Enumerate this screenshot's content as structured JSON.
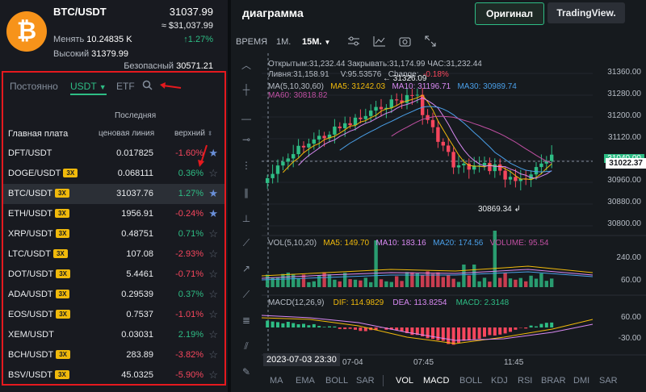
{
  "header": {
    "coin_symbol": "₿",
    "pair": "BTC/USDT",
    "price": "31037.99",
    "price_usd": "≈ $31,037.99",
    "change_label": "Менять",
    "change_value": "10.24835 K",
    "change_pct": "↑1.27%",
    "high_label": "Высокий",
    "high_value": "31379.99",
    "safe_label": "Безопасный",
    "safe_value": "30571.21"
  },
  "market": {
    "tabs": [
      {
        "label": "Постоянно"
      },
      {
        "label": "USDT"
      },
      {
        "label": "ETF"
      }
    ],
    "search_icon": "search-icon",
    "col_name": "Главная плата",
    "col_last_top": "Последняя",
    "col_last": "ценовая линия",
    "col_upper": "верхний",
    "rows": [
      {
        "sym": "DFT/USDT",
        "lev": "",
        "price": "0.017825",
        "chg": "-1.60%",
        "dir": "down",
        "fav": true
      },
      {
        "sym": "DOGE/USDT",
        "lev": "3X",
        "price": "0.068111",
        "chg": "0.36%",
        "dir": "up",
        "fav": false
      },
      {
        "sym": "BTC/USDT",
        "lev": "3X",
        "price": "31037.76",
        "chg": "1.27%",
        "dir": "up",
        "fav": true
      },
      {
        "sym": "ETH/USDT",
        "lev": "3X",
        "price": "1956.91",
        "chg": "-0.24%",
        "dir": "down",
        "fav": true
      },
      {
        "sym": "XRP/USDT",
        "lev": "3X",
        "price": "0.48751",
        "chg": "0.71%",
        "dir": "up",
        "fav": false
      },
      {
        "sym": "LTC/USDT",
        "lev": "3X",
        "price": "107.08",
        "chg": "-2.93%",
        "dir": "down",
        "fav": false
      },
      {
        "sym": "DOT/USDT",
        "lev": "3X",
        "price": "5.4461",
        "chg": "-0.71%",
        "dir": "down",
        "fav": false
      },
      {
        "sym": "ADA/USDT",
        "lev": "3X",
        "price": "0.29539",
        "chg": "0.37%",
        "dir": "up",
        "fav": false
      },
      {
        "sym": "EOS/USDT",
        "lev": "3X",
        "price": "0.7537",
        "chg": "-1.01%",
        "dir": "down",
        "fav": false
      },
      {
        "sym": "XEM/USDT",
        "lev": "",
        "price": "0.03031",
        "chg": "2.19%",
        "dir": "up",
        "fav": false
      },
      {
        "sym": "BCH/USDT",
        "lev": "3X",
        "price": "283.89",
        "chg": "-3.82%",
        "dir": "down",
        "fav": false
      },
      {
        "sym": "BSV/USDT",
        "lev": "3X",
        "price": "45.0325",
        "chg": "-5.90%",
        "dir": "down",
        "fav": false
      }
    ]
  },
  "chart": {
    "title": "диаграмма",
    "btn_original": "Оригинал",
    "btn_tradingview": "TradingView.",
    "timeframes": [
      "ВРЕМЯ",
      "1М.",
      "15М."
    ],
    "active_timeframe": "15М.",
    "ohlc_line1": "Открытым:31,232.44   Закрывать:31,174.99   ЧАС:31,232.44",
    "ohlc_line2_a": "Ливня:31,158.91",
    "ohlc_line2_b": "V:95.53576",
    "ohlc_line2_c": "Change:",
    "ohlc_line2_d": "-0.18%",
    "high_marker": "31326.09",
    "low_marker": "30869.34",
    "ma_label": "MA(5,10,30,60)",
    "ma5": "MA5: 31242.03",
    "ma10": "MA10: 31196.71",
    "ma30": "MA30: 30989.74",
    "ma60": "MA60: 30818.82",
    "price_axis": [
      "31360.00",
      "31280.00",
      "31200.00",
      "31120.00",
      "31040.00",
      "30960.00",
      "30880.00",
      "30800.00"
    ],
    "current_price_tag": "31022.37",
    "vol_label": "VOL(5,10,20)",
    "vol_ma5": "MA5: 149.70",
    "vol_ma10": "MA10: 183.16",
    "vol_ma20": "MA20: 174.56",
    "vol_vol": "VOLUME: 95.54",
    "vol_axis": [
      "240.00",
      "60.00"
    ],
    "macd_label": "MACD(12,26,9)",
    "macd_dif": "DIF: 114.9829",
    "macd_dea": "DEA: 113.8254",
    "macd_val": "MACD: 2.3148",
    "macd_axis": [
      "60.00",
      "-30.00"
    ],
    "time_axis": [
      "07-04",
      "07:45",
      "11:45"
    ],
    "crosshair_time": "2023-07-03 23:30",
    "bottom_indicators": [
      "MA",
      "EMA",
      "BOLL",
      "SAR",
      "VOL",
      "MACD",
      "BOLL",
      "KDJ",
      "RSI",
      "BRAR",
      "DMI",
      "SAR"
    ],
    "colors": {
      "up": "#2ebd85",
      "down": "#f6465d",
      "ma5": "#f0b90b",
      "ma10": "#d889f2",
      "ma30": "#4a9fe8",
      "ma60": "#c04fa2"
    }
  }
}
